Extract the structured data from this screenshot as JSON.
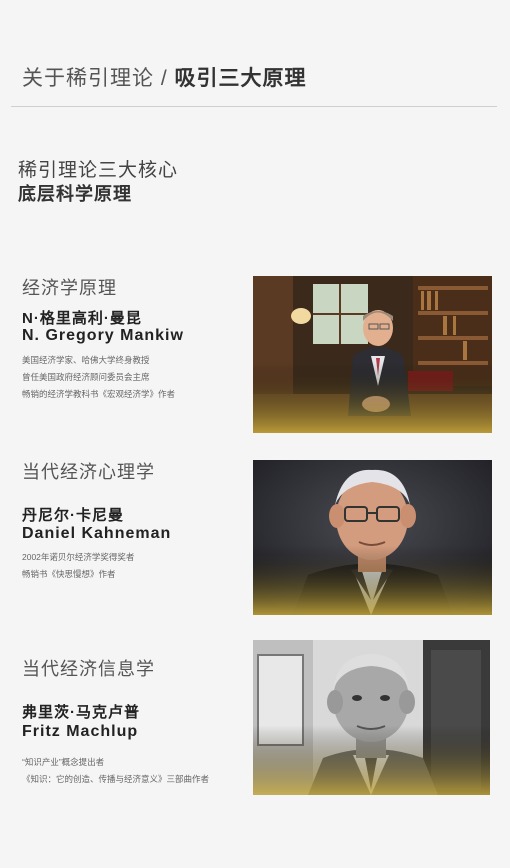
{
  "header": {
    "prefix": "关于稀引理论 /",
    "title": "吸引三大原理"
  },
  "intro": {
    "line1": "稀引理论三大核心",
    "line2": "底层科学原理"
  },
  "people": [
    {
      "field": "经济学原理",
      "name_cn": "N·格里高利·曼昆",
      "name_en": "N. Gregory Mankiw",
      "desc": [
        "美国经济学家、哈佛大学终身教授",
        "曾任美国政府经济顾问委员会主席",
        "畅销的经济学教科书《宏观经济学》作者"
      ],
      "photo": "mankiw-photo"
    },
    {
      "field": "当代经济心理学",
      "name_cn": "丹尼尔·卡尼曼",
      "name_en": "Daniel Kahneman",
      "desc": [
        "2002年诺贝尔经济学奖得奖者",
        "畅销书《快思慢想》作者"
      ],
      "photo": "kahneman-photo"
    },
    {
      "field": "当代经济信息学",
      "name_cn": "弗里茨·马克卢普",
      "name_en": "Fritz Machlup",
      "desc": [
        "“知识产业”概念提出者",
        "《知识：它的创造、传播与经济意义》三部曲作者"
      ],
      "photo": "machlup-photo"
    }
  ],
  "colors": {
    "accent_gold": "#c7a93a",
    "background": "#f5f5f6"
  }
}
